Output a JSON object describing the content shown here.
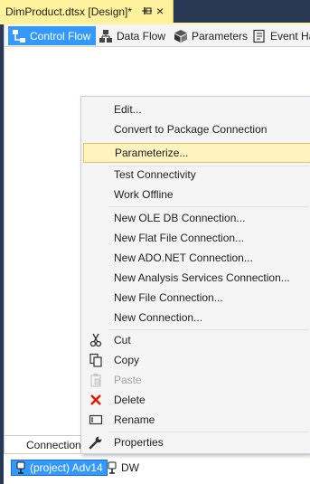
{
  "document_tab": {
    "title": "DimProduct.dtsx [Design]*",
    "close_glyph": "×"
  },
  "designer_tabs": [
    {
      "label": "Control Flow",
      "icon": "control-flow-icon",
      "active": true
    },
    {
      "label": "Data Flow",
      "icon": "data-flow-icon",
      "active": false
    },
    {
      "label": "Parameters",
      "icon": "parameters-icon",
      "active": false
    },
    {
      "label": "Event Ha",
      "icon": "event-handlers-icon",
      "active": false
    }
  ],
  "context_menu": {
    "items": [
      {
        "label": "Edit...",
        "icon": null,
        "disabled": false
      },
      {
        "label": "Convert to Package Connection",
        "icon": null,
        "disabled": false
      },
      {
        "label": "Parameterize...",
        "icon": null,
        "disabled": false,
        "highlighted": true
      },
      {
        "label": "Test Connectivity",
        "icon": null,
        "disabled": false
      },
      {
        "label": "Work Offline",
        "icon": null,
        "disabled": false
      },
      {
        "label": "New OLE DB Connection...",
        "icon": null,
        "disabled": false
      },
      {
        "label": "New Flat File Connection...",
        "icon": null,
        "disabled": false
      },
      {
        "label": "New ADO.NET Connection...",
        "icon": null,
        "disabled": false
      },
      {
        "label": "New Analysis Services Connection...",
        "icon": null,
        "disabled": false
      },
      {
        "label": "New File Connection...",
        "icon": null,
        "disabled": false
      },
      {
        "label": "New Connection...",
        "icon": null,
        "disabled": false
      },
      {
        "label": "Cut",
        "icon": "scissors-icon",
        "disabled": false
      },
      {
        "label": "Copy",
        "icon": "copy-icon",
        "disabled": false
      },
      {
        "label": "Paste",
        "icon": "paste-icon",
        "disabled": true
      },
      {
        "label": "Delete",
        "icon": "delete-icon",
        "disabled": false
      },
      {
        "label": "Rename",
        "icon": "rename-icon",
        "disabled": false
      },
      {
        "label": "Properties",
        "icon": "wrench-icon",
        "disabled": false
      }
    ]
  },
  "connection_managers": {
    "tab_label": "Connection",
    "items": [
      {
        "label": "(project) Adv14",
        "selected": true
      },
      {
        "label": "DW",
        "selected": false
      }
    ]
  },
  "colors": {
    "accent": "#3399ff",
    "tab_highlight": "#fff29d",
    "menu_hover": "#fdf4bf",
    "frame": "#293955",
    "delete_red": "#e51400"
  }
}
